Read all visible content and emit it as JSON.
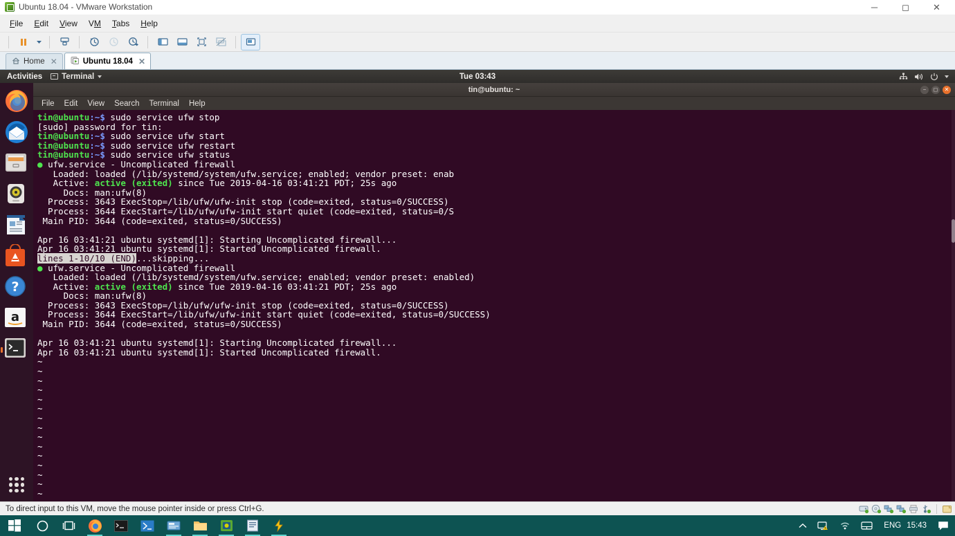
{
  "vmware": {
    "window_title": "Ubuntu 18.04 - VMware Workstation",
    "app_icon": "vmware-vm-icon",
    "window_buttons": [
      {
        "name": "minimize-button",
        "glyph": "─"
      },
      {
        "name": "maximize-button",
        "glyph": "☐"
      },
      {
        "name": "close-button",
        "glyph": "✕"
      }
    ],
    "menus": [
      {
        "label": "File",
        "accel": "F"
      },
      {
        "label": "Edit",
        "accel": "E"
      },
      {
        "label": "View",
        "accel": "V"
      },
      {
        "label": "VM",
        "accel": "M"
      },
      {
        "label": "Tabs",
        "accel": "T"
      },
      {
        "label": "Help",
        "accel": "H"
      }
    ],
    "toolbar": [
      {
        "name": "suspend-button",
        "icon": "pause-icon"
      },
      {
        "name": "power-options-dropdown",
        "icon": "chevron-down-icon"
      },
      {
        "name": "manage-snapshots-button",
        "icon": "snapshot-icon"
      },
      {
        "name": "take-snapshot-button",
        "icon": "snapshot-clock-icon"
      },
      {
        "name": "revert-snapshot-button",
        "icon": "snapshot-revert-icon"
      },
      {
        "name": "snapshot-manager-button",
        "icon": "snapshot-manager-icon"
      },
      {
        "name": "show-library-button",
        "icon": "sidebar-panel-icon"
      },
      {
        "name": "show-thumbnail-bar-button",
        "icon": "thumbnail-bar-icon"
      },
      {
        "name": "fullscreen-button",
        "icon": "fullscreen-icon"
      },
      {
        "name": "unity-mode-button",
        "icon": "unity-mode-icon"
      },
      {
        "name": "console-view-button",
        "icon": "console-view-icon"
      }
    ],
    "tabs": [
      {
        "label": "Home",
        "icon": "home-icon",
        "active": false
      },
      {
        "label": "Ubuntu 18.04",
        "icon": "vm-icon",
        "active": true
      }
    ],
    "status_message": "To direct input to this VM, move the mouse pointer inside or press Ctrl+G.",
    "device_icons": [
      {
        "name": "hard-disk-icon"
      },
      {
        "name": "cd-dvd-icon"
      },
      {
        "name": "network-adapter-icon"
      },
      {
        "name": "network-adapter-2-icon"
      },
      {
        "name": "printer-icon"
      },
      {
        "name": "usb-device-icon"
      },
      {
        "name": "shared-folder-icon"
      }
    ]
  },
  "ubuntu": {
    "topbar": {
      "activities": "Activities",
      "app_menu": "Terminal",
      "app_menu_icon": "terminal-icon",
      "clock": "Tue 03:43",
      "indicators": [
        {
          "name": "network-icon"
        },
        {
          "name": "volume-icon"
        },
        {
          "name": "power-icon"
        },
        {
          "name": "system-menu-chevron-icon"
        }
      ]
    },
    "dock": [
      {
        "name": "dock-item-firefox",
        "label": "Firefox",
        "running": false
      },
      {
        "name": "dock-item-thunderbird",
        "label": "Thunderbird Mail",
        "running": false
      },
      {
        "name": "dock-item-files",
        "label": "Files",
        "running": false
      },
      {
        "name": "dock-item-rhythmbox",
        "label": "Rhythmbox",
        "running": false
      },
      {
        "name": "dock-item-libreoffice-writer",
        "label": "LibreOffice Writer",
        "running": false
      },
      {
        "name": "dock-item-ubuntu-software",
        "label": "Ubuntu Software",
        "running": false
      },
      {
        "name": "dock-item-help",
        "label": "Help",
        "running": false
      },
      {
        "name": "dock-item-amazon",
        "label": "Amazon",
        "running": false
      },
      {
        "name": "dock-item-terminal",
        "label": "Terminal",
        "running": true
      }
    ],
    "dock_show_apps": "Show Applications"
  },
  "terminal": {
    "title": "tin@ubuntu: ~",
    "menus": [
      "File",
      "Edit",
      "View",
      "Search",
      "Terminal",
      "Help"
    ],
    "window_buttons": [
      {
        "name": "terminal-minimize-button",
        "glyph": "−"
      },
      {
        "name": "terminal-maximize-button",
        "glyph": "□"
      },
      {
        "name": "terminal-close-button",
        "glyph": "✕"
      }
    ],
    "prompt_user": "tin@ubuntu",
    "prompt_path": ":~$ ",
    "lines": [
      {
        "type": "prompt",
        "cmd": "sudo service ufw stop"
      },
      {
        "type": "plain",
        "text": "[sudo] password for tin:"
      },
      {
        "type": "prompt",
        "cmd": "sudo service ufw start"
      },
      {
        "type": "prompt",
        "cmd": "sudo service ufw restart"
      },
      {
        "type": "prompt",
        "cmd": "sudo service ufw status"
      },
      {
        "type": "dot",
        "text": "ufw.service - Uncomplicated firewall"
      },
      {
        "type": "plain",
        "text": "   Loaded: loaded (/lib/systemd/system/ufw.service; enabled; vendor preset: enab"
      },
      {
        "type": "active",
        "pre": "   Active: ",
        "hl": "active (exited)",
        "post": " since Tue 2019-04-16 03:41:21 PDT; 25s ago"
      },
      {
        "type": "plain",
        "text": "     Docs: man:ufw(8)"
      },
      {
        "type": "plain",
        "text": "  Process: 3643 ExecStop=/lib/ufw/ufw-init stop (code=exited, status=0/SUCCESS)"
      },
      {
        "type": "plain",
        "text": "  Process: 3644 ExecStart=/lib/ufw/ufw-init start quiet (code=exited, status=0/S"
      },
      {
        "type": "plain",
        "text": " Main PID: 3644 (code=exited, status=0/SUCCESS)"
      },
      {
        "type": "plain",
        "text": ""
      },
      {
        "type": "plain",
        "text": "Apr 16 03:41:21 ubuntu systemd[1]: Starting Uncomplicated firewall..."
      },
      {
        "type": "plain",
        "text": "Apr 16 03:41:21 ubuntu systemd[1]: Started Uncomplicated firewall."
      },
      {
        "type": "pager",
        "hl": "lines 1-10/10 (END)",
        "post": "...skipping..."
      },
      {
        "type": "dot",
        "text": "ufw.service - Uncomplicated firewall"
      },
      {
        "type": "plain",
        "text": "   Loaded: loaded (/lib/systemd/system/ufw.service; enabled; vendor preset: enabled)"
      },
      {
        "type": "active",
        "pre": "   Active: ",
        "hl": "active (exited)",
        "post": " since Tue 2019-04-16 03:41:21 PDT; 25s ago"
      },
      {
        "type": "plain",
        "text": "     Docs: man:ufw(8)"
      },
      {
        "type": "plain",
        "text": "  Process: 3643 ExecStop=/lib/ufw/ufw-init stop (code=exited, status=0/SUCCESS)"
      },
      {
        "type": "plain",
        "text": "  Process: 3644 ExecStart=/lib/ufw/ufw-init start quiet (code=exited, status=0/SUCCESS)"
      },
      {
        "type": "plain",
        "text": " Main PID: 3644 (code=exited, status=0/SUCCESS)"
      },
      {
        "type": "plain",
        "text": ""
      },
      {
        "type": "plain",
        "text": "Apr 16 03:41:21 ubuntu systemd[1]: Starting Uncomplicated firewall..."
      },
      {
        "type": "plain",
        "text": "Apr 16 03:41:21 ubuntu systemd[1]: Started Uncomplicated firewall."
      },
      {
        "type": "plain",
        "text": "~"
      },
      {
        "type": "plain",
        "text": "~"
      },
      {
        "type": "plain",
        "text": "~"
      },
      {
        "type": "plain",
        "text": "~"
      },
      {
        "type": "plain",
        "text": "~"
      },
      {
        "type": "plain",
        "text": "~"
      },
      {
        "type": "plain",
        "text": "~"
      },
      {
        "type": "plain",
        "text": "~"
      },
      {
        "type": "plain",
        "text": "~"
      },
      {
        "type": "plain",
        "text": "~"
      },
      {
        "type": "plain",
        "text": "~"
      },
      {
        "type": "plain",
        "text": "~"
      },
      {
        "type": "plain",
        "text": "~"
      },
      {
        "type": "plain",
        "text": "~"
      },
      {
        "type": "plain",
        "text": "~"
      }
    ]
  },
  "windows_taskbar": {
    "start": "start-button",
    "items": [
      {
        "name": "cortana-search-button",
        "icon": "circle-icon"
      },
      {
        "name": "task-view-button",
        "icon": "task-view-icon"
      },
      {
        "name": "taskbar-firefox",
        "icon": "firefox-icon",
        "open": true
      },
      {
        "name": "taskbar-command-prompt",
        "icon": "cmd-icon",
        "open": false
      },
      {
        "name": "taskbar-powershell",
        "icon": "powershell-icon",
        "open": false
      },
      {
        "name": "taskbar-remote-desktop",
        "icon": "remote-desktop-icon",
        "open": true
      },
      {
        "name": "taskbar-file-explorer",
        "icon": "folder-icon",
        "open": true
      },
      {
        "name": "taskbar-vmware",
        "icon": "vmware-icon",
        "open": true
      },
      {
        "name": "taskbar-notepad",
        "icon": "notepad-icon",
        "open": true
      },
      {
        "name": "taskbar-putty",
        "icon": "putty-icon",
        "open": true
      }
    ],
    "tray": [
      {
        "name": "show-hidden-icons-button",
        "icon": "chevron-up-icon"
      },
      {
        "name": "network-warning-icon",
        "icon": "monitor-warning-icon"
      },
      {
        "name": "wifi-icon",
        "icon": "wifi-icon"
      },
      {
        "name": "touchpad-icon",
        "icon": "touchpad-icon"
      }
    ],
    "language": "ENG",
    "clock": "15:43",
    "action_center": "action-center-icon"
  },
  "colors": {
    "terminal_bg": "#300a24",
    "terminal_green": "#4ee44e",
    "taskbar_teal": "#0d5352",
    "ubuntu_orange": "#e8712c"
  }
}
